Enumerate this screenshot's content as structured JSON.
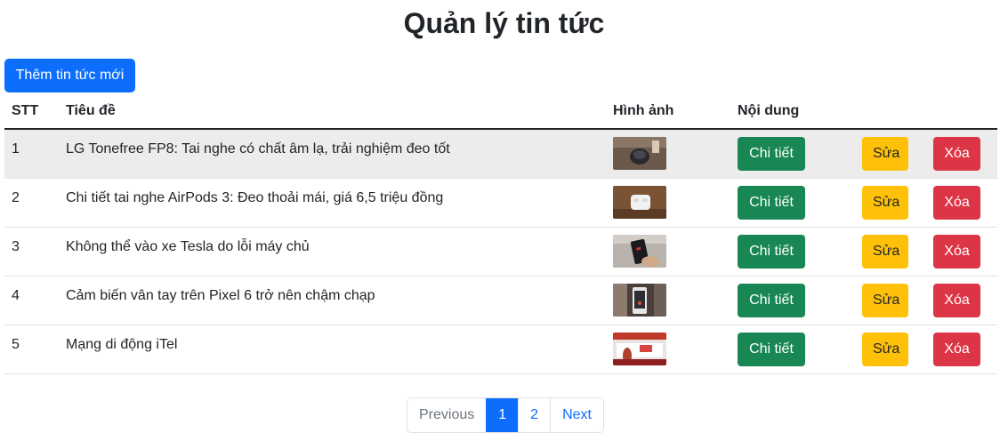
{
  "header": {
    "title": "Quản lý tin tức"
  },
  "toolbar": {
    "add_label": "Thêm tin tức mới"
  },
  "table": {
    "columns": [
      "STT",
      "Tiêu đề",
      "Hình ảnh",
      "Nội dung"
    ],
    "rows": [
      {
        "stt": "1",
        "title": "LG Tonefree FP8: Tai nghe có chất âm lạ, trải nghiệm đeo tốt",
        "image": "earbuds-case-thumbnail",
        "detail": "Chi tiết",
        "edit": "Sửa",
        "delete": "Xóa"
      },
      {
        "stt": "2",
        "title": "Chi tiết tai nghe AirPods 3: Đeo thoải mái, giá 6,5 triệu đồng",
        "image": "airpods-thumbnail",
        "detail": "Chi tiết",
        "edit": "Sửa",
        "delete": "Xóa"
      },
      {
        "stt": "3",
        "title": "Không thể vào xe Tesla do lỗi máy chủ",
        "image": "phone-hand-thumbnail",
        "detail": "Chi tiết",
        "edit": "Sửa",
        "delete": "Xóa"
      },
      {
        "stt": "4",
        "title": "Cảm biến vân tay trên Pixel 6 trở nên chậm chạp",
        "image": "pixel-phone-thumbnail",
        "detail": "Chi tiết",
        "edit": "Sửa",
        "delete": "Xóa"
      },
      {
        "stt": "5",
        "title": "Mạng di động iTel",
        "image": "itel-event-thumbnail",
        "detail": "Chi tiết",
        "edit": "Sửa",
        "delete": "Xóa"
      }
    ]
  },
  "pagination": {
    "previous": "Previous",
    "pages": [
      "1",
      "2"
    ],
    "active_page": "1",
    "next": "Next"
  },
  "colors": {
    "primary": "#0d6efd",
    "success": "#198754",
    "warning": "#ffc107",
    "danger": "#dc3545"
  }
}
